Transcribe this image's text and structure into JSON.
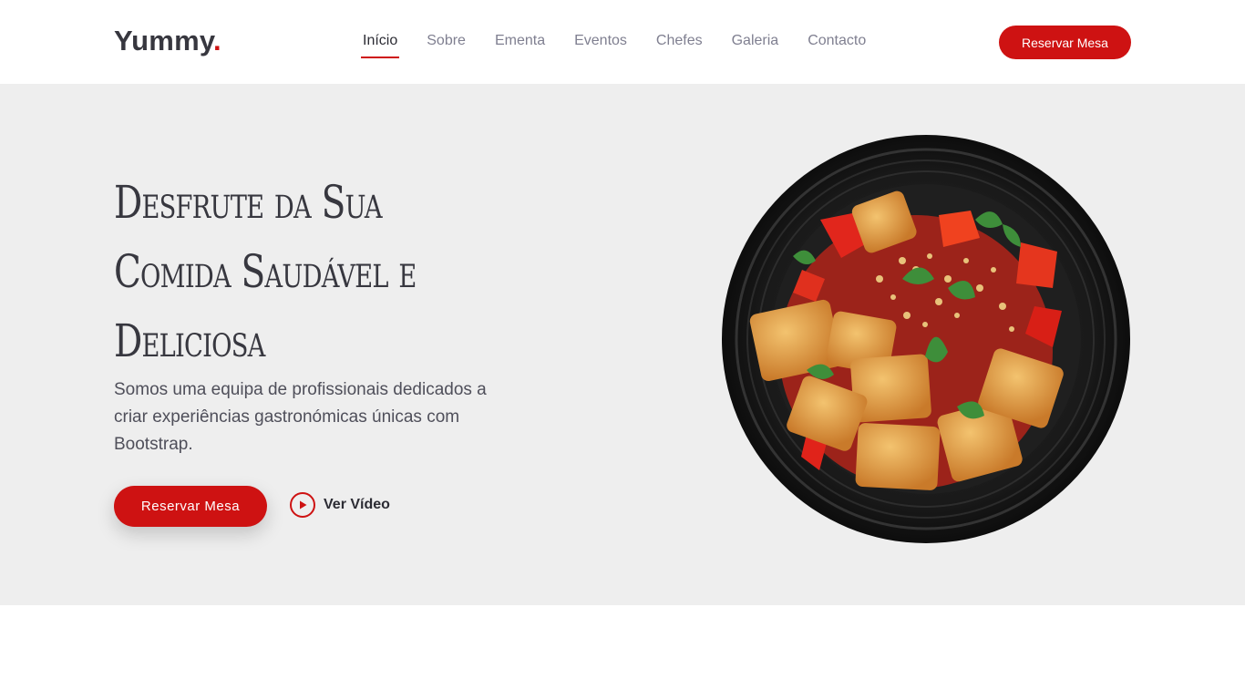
{
  "header": {
    "logo_text": "Yummy",
    "logo_dot": ".",
    "nav": [
      {
        "label": "Início",
        "active": true
      },
      {
        "label": "Sobre",
        "active": false
      },
      {
        "label": "Ementa",
        "active": false
      },
      {
        "label": "Eventos",
        "active": false
      },
      {
        "label": "Chefes",
        "active": false
      },
      {
        "label": "Galeria",
        "active": false
      },
      {
        "label": "Contacto",
        "active": false
      }
    ],
    "cta_label": "Reservar Mesa"
  },
  "hero": {
    "title_lines": [
      "Desfrute da Sua",
      "Comida Saudável e",
      "Deliciosa"
    ],
    "description": "Somos uma equipa de profissionais dedicados a criar experiências gastronómicas únicas com Bootstrap.",
    "cta_label": "Reservar Mesa",
    "video_label": "Ver Vídeo",
    "video_icon": "play-circle-icon",
    "image_alt_icon": "dish-image"
  },
  "colors": {
    "accent": "#ce1212",
    "hero_bg": "#eeeeee",
    "text_dark": "#37373f",
    "nav_text": "#7f7f90"
  }
}
